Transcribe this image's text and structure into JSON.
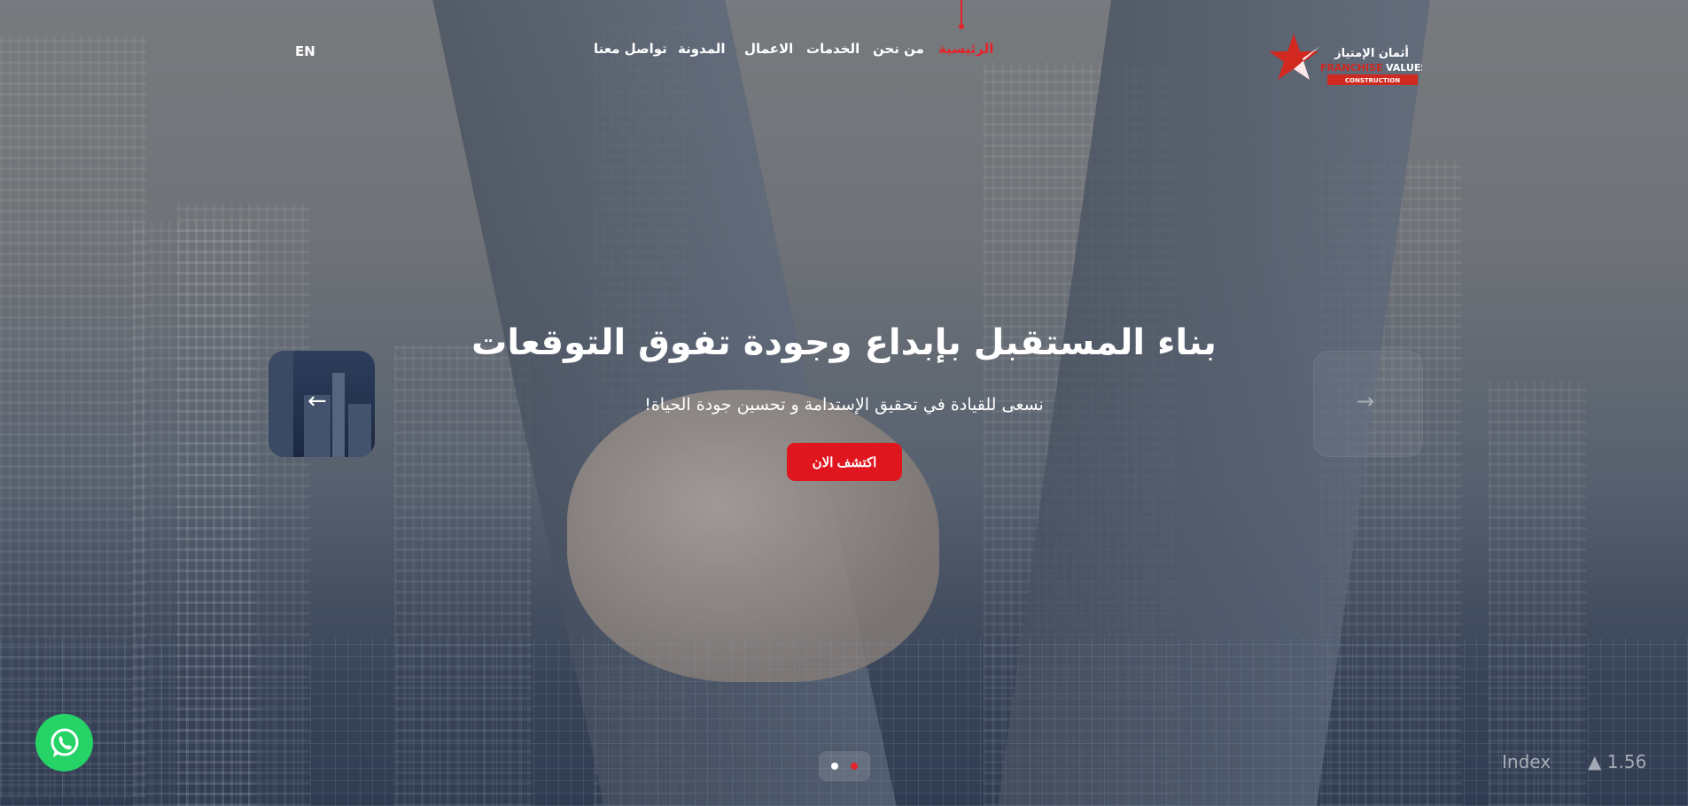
{
  "logo": {
    "arabic": "أثمان الإمتياز",
    "english": "FRANCHISE VALUES",
    "tagline": "CONSTRUCTION",
    "colors": {
      "red": "#d1281f",
      "white": "#ffffff"
    }
  },
  "nav": {
    "items": [
      {
        "label": "الرئيسية",
        "active": true
      },
      {
        "label": "من نحن"
      },
      {
        "label": "الخدمات"
      },
      {
        "label": "الاعمال"
      },
      {
        "label": "المدونة"
      },
      {
        "label": "تواصل معنا"
      }
    ],
    "language": "EN"
  },
  "hero": {
    "title": "بناء المستقبل بإبداع وجودة تفوق التوقعات",
    "subtitle": "نسعى للقيادة في تحقيق الإستدامة و تحسين جودة الحياة!",
    "cta": "اكتشف الان",
    "prev_icon": "arrow-left-icon",
    "next_icon": "arrow-right-icon"
  },
  "slider": {
    "slides": 2,
    "active_slide": 2
  },
  "background_text": {
    "index_label": "Index",
    "index_value": "▲ 1.56"
  },
  "colors": {
    "accent": "#e0161f",
    "whatsapp": "#25d366"
  }
}
